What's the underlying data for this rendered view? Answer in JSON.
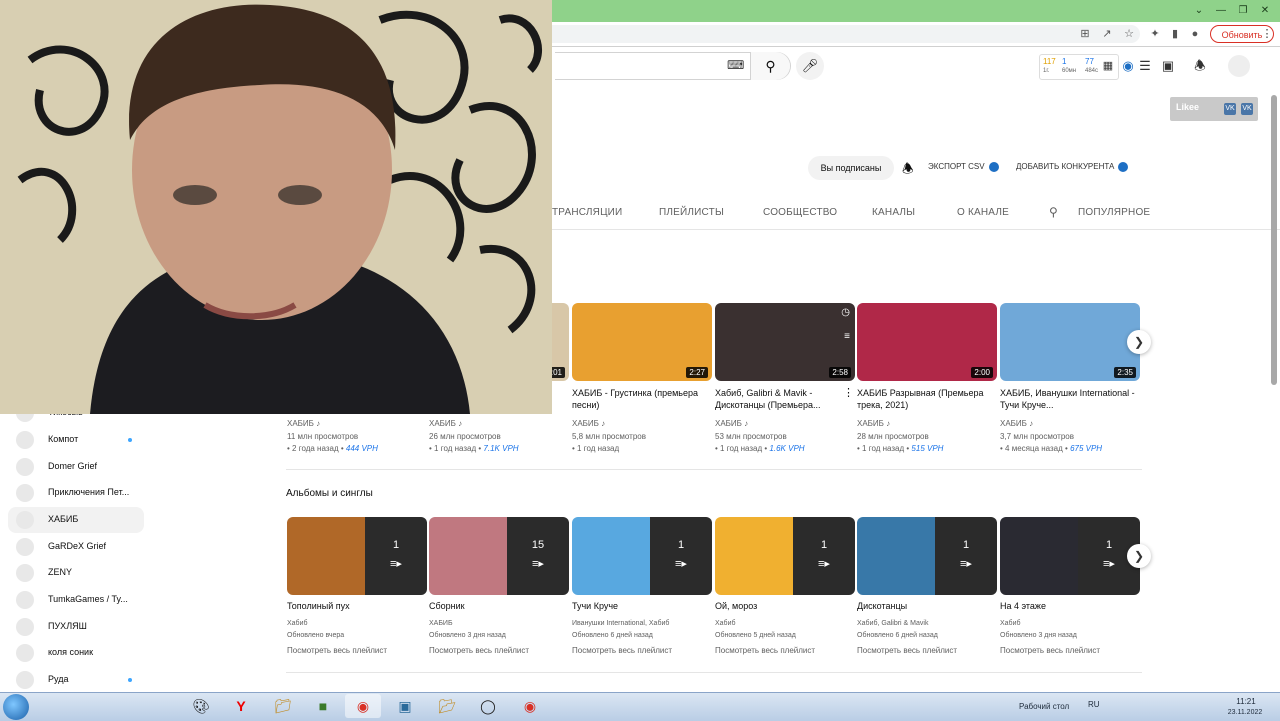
{
  "browser": {
    "update_label": "Обновить",
    "toolbar_icons": [
      "install-icon",
      "share-icon",
      "star-icon",
      "extensions-icon",
      "sidebar-icon",
      "profile-icon"
    ]
  },
  "header": {
    "stats": {
      "v1": "117",
      "v2": "1",
      "v3": "77",
      "l1": "1г.",
      "l2": "60мн",
      "l3": "484с"
    }
  },
  "likee": {
    "label": "Likee",
    "vk1": "VK",
    "vk2": "VK"
  },
  "channel": {
    "subscribed_label": "Вы подписаны",
    "export_label": "ЭКСПОРТ CSV",
    "add_competitor_label": "ДОБАВИТЬ КОНКУРЕНТА"
  },
  "tabs": [
    "ТРАНСЛЯЦИИ",
    "ПЛЕЙЛИСТЫ",
    "СООБЩЕСТВО",
    "КАНАЛЫ",
    "О КАНАЛЕ",
    "ПОПУЛЯРНОЕ"
  ],
  "sidebar": {
    "items": [
      {
        "label": "Тикосыь",
        "dot": false
      },
      {
        "label": "Компот",
        "dot": true
      },
      {
        "label": "Domer Grief",
        "dot": false
      },
      {
        "label": "Приключения Пет...",
        "dot": false
      },
      {
        "label": "ХАБИБ",
        "dot": false
      },
      {
        "label": "GaRDeX Grief",
        "dot": false
      },
      {
        "label": "ZENY",
        "dot": false
      },
      {
        "label": "TumkaGames / Ty...",
        "dot": false
      },
      {
        "label": "ПУХЛЯШ",
        "dot": false
      },
      {
        "label": "коля соник",
        "dot": false
      },
      {
        "label": "Руда",
        "dot": true
      }
    ]
  },
  "videos": [
    {
      "title": "",
      "channel": "ХАБИБ",
      "views": "11 млн просмотров",
      "ago": "2 года назад",
      "vph": "444 VPH",
      "duration": ""
    },
    {
      "title": "",
      "channel": "ХАБИБ",
      "views": "26 млн просмотров",
      "ago": "1 год назад",
      "vph": "7.1K VPH",
      "duration": "3:01"
    },
    {
      "title": "ХАБИБ - Грустинка (премьера песни)",
      "channel": "ХАБИБ",
      "views": "5,8 млн просмотров",
      "ago": "1 год назад",
      "vph": "",
      "duration": "2:27"
    },
    {
      "title": "Хабиб, Galibri & Mavik - Дискотанцы (Премьера...",
      "channel": "ХАБИБ",
      "views": "53 млн просмотров",
      "ago": "1 год назад",
      "vph": "1.6K VPH",
      "duration": "2:58"
    },
    {
      "title": "ХАБИБ Разрывная (Премьера трека, 2021)",
      "channel": "ХАБИБ",
      "views": "28 млн просмотров",
      "ago": "1 год назад",
      "vph": "515 VPH",
      "duration": "2:00"
    },
    {
      "title": "ХАБИБ, Иванушки International - Тучи Круче...",
      "channel": "ХАБИБ",
      "views": "3,7 млн просмотров",
      "ago": "4 месяца назад",
      "vph": "675 VPH",
      "duration": "2:35"
    }
  ],
  "albums_section_title": "Альбомы и синглы",
  "albums": [
    {
      "title": "Тополиный пух",
      "artist": "Хабиб",
      "updated": "Обновлено вчера",
      "count": "1",
      "view_all": "Посмотреть весь плейлист"
    },
    {
      "title": "Сборник",
      "artist": "ХАБИБ",
      "updated": "Обновлено 3 дня назад",
      "count": "15",
      "view_all": "Посмотреть весь плейлист"
    },
    {
      "title": "Тучи Круче",
      "artist": "Иванушки International, Хабиб",
      "updated": "Обновлено 6 дней назад",
      "count": "1",
      "view_all": "Посмотреть весь плейлист"
    },
    {
      "title": "Ой, мороз",
      "artist": "Хабиб",
      "updated": "Обновлено 5 дней назад",
      "count": "1",
      "view_all": "Посмотреть весь плейлист"
    },
    {
      "title": "Дискотанцы",
      "artist": "Хабиб, Galibri & Mavik",
      "updated": "Обновлено 6 дней назад",
      "count": "1",
      "view_all": "Посмотреть весь плейлист"
    },
    {
      "title": "На 4 этаже",
      "artist": "Хабиб",
      "updated": "Обновлено 3 дня назад",
      "count": "1",
      "view_all": "Посмотреть весь плейлист"
    }
  ],
  "thumb_colors": {
    "videos": [
      "#3a6a3a",
      "#d8c7a8",
      "#e8a030",
      "#3a3030",
      "#b02848",
      "#70a8d8"
    ],
    "albums": [
      "#b06828",
      "#c07880",
      "#58a8e0",
      "#f0b030",
      "#3878a8",
      "#2a2a32"
    ]
  },
  "taskbar": {
    "desktop_label": "Рабочий стол",
    "lang": "RU",
    "time": "11:21",
    "date": "23.11.2022",
    "apps": [
      "paint-icon",
      "yandex-icon",
      "explorer-icon",
      "minecraft-icon",
      "chrome-icon",
      "window-icon",
      "folder-icon",
      "obs-icon",
      "chrome-icon"
    ]
  }
}
